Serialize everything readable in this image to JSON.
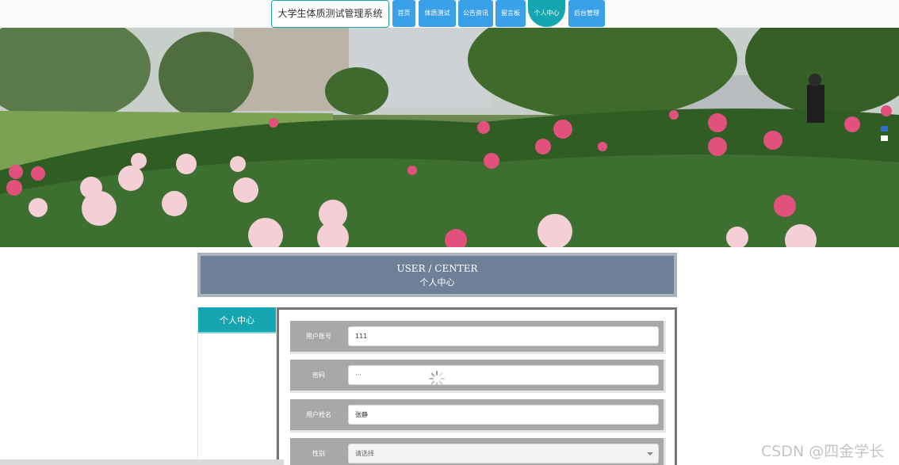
{
  "header": {
    "site_title": "大学生体质测试管理系统",
    "nav": [
      {
        "label": "首页",
        "active": false
      },
      {
        "label": "体质测试",
        "active": false
      },
      {
        "label": "公告资讯",
        "active": false
      },
      {
        "label": "留言板",
        "active": false
      },
      {
        "label": "个人中心",
        "active": true
      },
      {
        "label": "后台管理",
        "active": false
      }
    ]
  },
  "banner": {
    "slide_count": 2,
    "active_slide": 1
  },
  "section": {
    "title_en": "USER / CENTER",
    "title_cn": "个人中心"
  },
  "sidebar": {
    "items": [
      {
        "label": "个人中心"
      }
    ]
  },
  "form": {
    "fields": [
      {
        "label": "用户账号",
        "value": "111"
      },
      {
        "label": "密码",
        "value": "···"
      },
      {
        "label": "用户姓名",
        "value": "张静"
      },
      {
        "label": "性别",
        "value": "请选择"
      }
    ]
  },
  "watermark": "CSDN @四金学长",
  "colors": {
    "nav_button": "#3aa0e8",
    "nav_active": "#16a6b1",
    "section_head": "#6d8097",
    "sidebar_active": "#16a6b1",
    "form_row": "#a8a8a8"
  }
}
